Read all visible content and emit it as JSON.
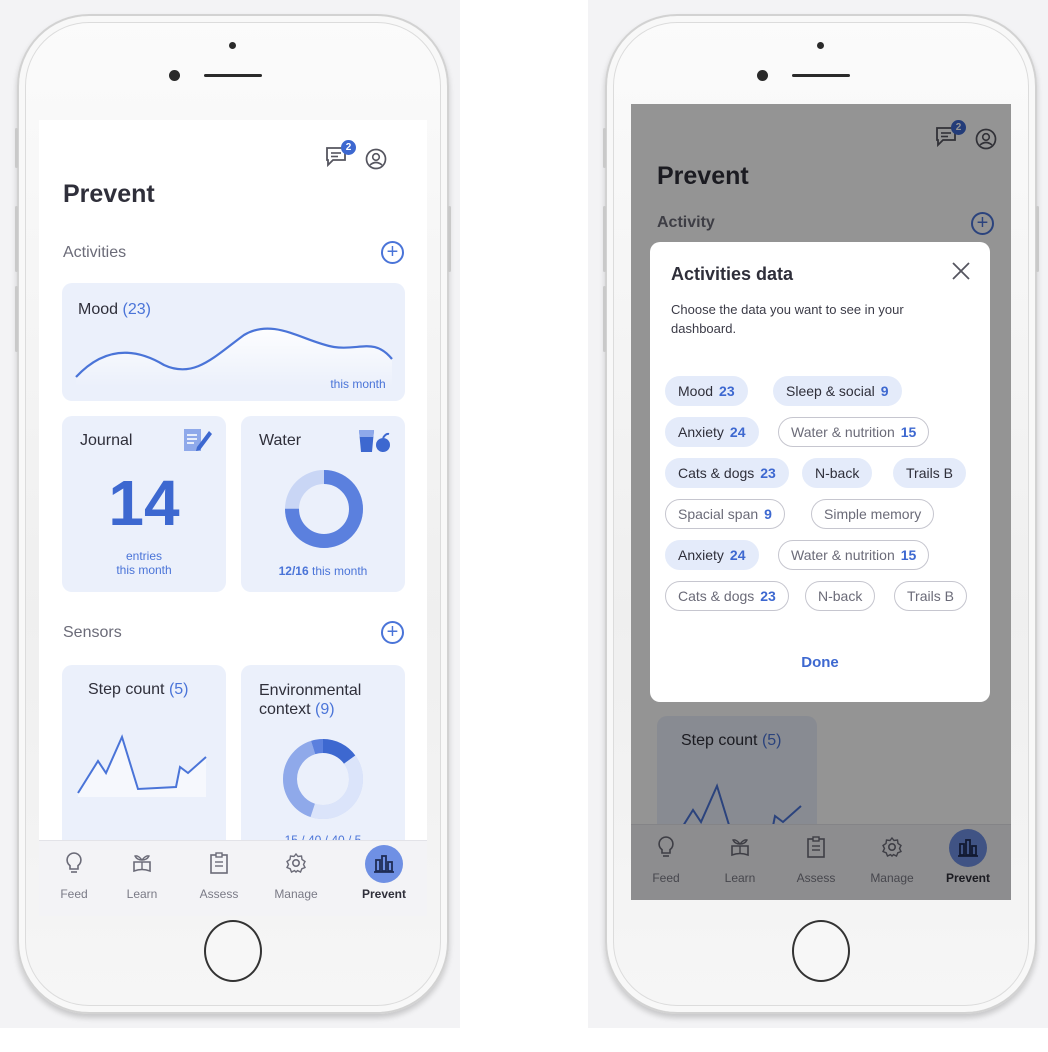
{
  "left": {
    "page_title": "Prevent",
    "messages_badge": "2",
    "activities": {
      "label": "Activities",
      "mood": {
        "name": "Mood",
        "count": "(23)",
        "caption": "this month"
      },
      "journal": {
        "name": "Journal",
        "value": "14",
        "caption_line1": "entries",
        "caption_line2": "this month"
      },
      "water": {
        "name": "Water",
        "value": "12/16",
        "caption": "this month",
        "progress": 0.75
      }
    },
    "sensors": {
      "label": "Sensors",
      "step_count": {
        "name": "Step count",
        "count": "(5)"
      },
      "environmental": {
        "name_line1": "Environmental",
        "name_line2": "context",
        "count": "(9)",
        "caption": "15 / 40 / 40 / 5"
      }
    }
  },
  "tabs": [
    {
      "label": "Feed",
      "icon": "bulb-icon"
    },
    {
      "label": "Learn",
      "icon": "book-plant-icon"
    },
    {
      "label": "Assess",
      "icon": "clipboard-icon"
    },
    {
      "label": "Manage",
      "icon": "gear-icon"
    },
    {
      "label": "Prevent",
      "icon": "bar-chart-icon"
    }
  ],
  "right": {
    "page_title": "Prevent",
    "messages_badge": "2",
    "section_label": "Activity",
    "step_count": {
      "name": "Step count",
      "count": "(5)"
    },
    "modal": {
      "title": "Activities data",
      "description": "Choose the data you want to see in your dashboard.",
      "chips": [
        {
          "label": "Mood",
          "count": "23",
          "selected": true
        },
        {
          "label": "Sleep & social",
          "count": "9",
          "selected": true
        },
        {
          "label": "Anxiety",
          "count": "24",
          "selected": true
        },
        {
          "label": "Water & nutrition",
          "count": "15",
          "selected": false
        },
        {
          "label": "Cats & dogs",
          "count": "23",
          "selected": true
        },
        {
          "label": "N-back",
          "count": "",
          "selected": true
        },
        {
          "label": "Trails B",
          "count": "",
          "selected": true
        },
        {
          "label": "Spacial span",
          "count": "9",
          "selected": false
        },
        {
          "label": "Simple memory",
          "count": "",
          "selected": false
        },
        {
          "label": "Anxiety",
          "count": "24",
          "selected": true
        },
        {
          "label": "Water & nutrition",
          "count": "15",
          "selected": false
        },
        {
          "label": "Cats & dogs",
          "count": "23",
          "selected": false
        },
        {
          "label": "N-back",
          "count": "",
          "selected": false
        },
        {
          "label": "Trails B",
          "count": "",
          "selected": false
        }
      ],
      "done_label": "Done"
    }
  },
  "colors": {
    "accent": "#4a74d8",
    "card_bg": "#ebf0fb",
    "text_dark": "#2f2f3a"
  }
}
